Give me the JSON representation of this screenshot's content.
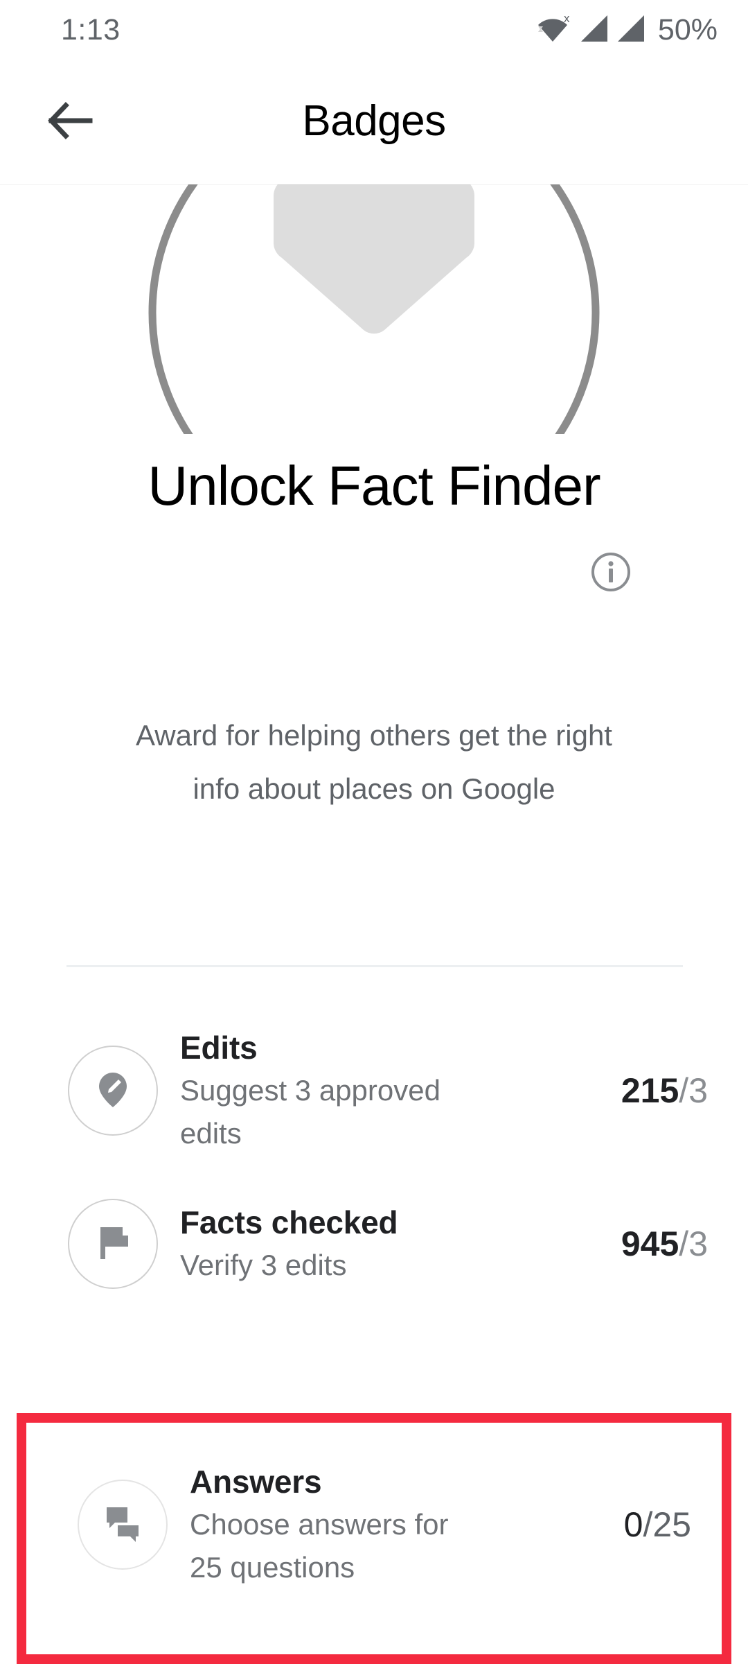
{
  "status_bar": {
    "time": "1:13",
    "battery": "50%",
    "icons": [
      "wifi-no-internet-icon",
      "signal-bar-icon",
      "signal-bar-icon"
    ]
  },
  "app_bar": {
    "back_icon": "back-arrow-icon",
    "title": "Badges"
  },
  "badge": {
    "emblem_icon": "locked-badge-icon",
    "ring": {
      "track_color": "#efefef",
      "progress_color": "#8c8c8c"
    },
    "title": "Unlock Fact Finder",
    "info_icon": "info-icon",
    "description": "Award for helping others get the right info about places on Google"
  },
  "tasks": [
    {
      "icon": "map-pin-edit-icon",
      "title": "Edits",
      "subtitle": "Suggest 3 approved edits",
      "current": "215",
      "target": "/3"
    },
    {
      "icon": "flag-icon",
      "title": "Facts checked",
      "subtitle": "Verify 3 edits",
      "current": "945",
      "target": "/3"
    },
    {
      "icon": "chat-bubbles-icon",
      "title": "Answers",
      "subtitle": "Choose answers for 25 questions",
      "current": "0",
      "target": "/25"
    }
  ],
  "highlight": {
    "color": "#f42a3f",
    "target_task": "Answers"
  }
}
